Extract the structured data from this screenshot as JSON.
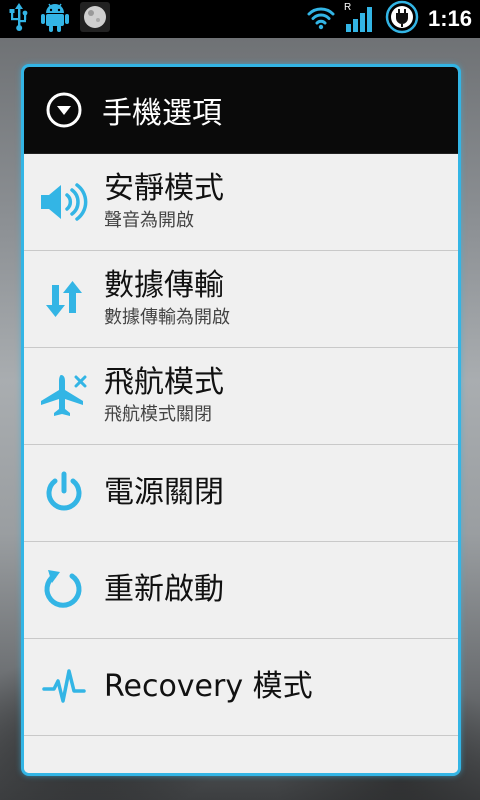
{
  "status_bar": {
    "time": "1:16",
    "signal_label": "R",
    "icons": [
      "usb-icon",
      "android-icon",
      "moon-icon",
      "wifi-icon",
      "cell-signal-icon",
      "battery-icon"
    ]
  },
  "dialog": {
    "title": "手機選項",
    "accent_color": "#33b5e5",
    "items": [
      {
        "title": "安靜模式",
        "subtitle": "聲音為開啟",
        "icon": "volume-icon"
      },
      {
        "title": "數據傳輸",
        "subtitle": "數據傳輸為開啟",
        "icon": "data-transfer-icon"
      },
      {
        "title": "飛航模式",
        "subtitle": "飛航模式關閉",
        "icon": "airplane-icon"
      },
      {
        "title": "電源關閉",
        "icon": "power-icon"
      },
      {
        "title": "重新啟動",
        "icon": "reboot-icon"
      },
      {
        "title": "Recovery 模式",
        "icon": "recovery-icon"
      }
    ]
  }
}
